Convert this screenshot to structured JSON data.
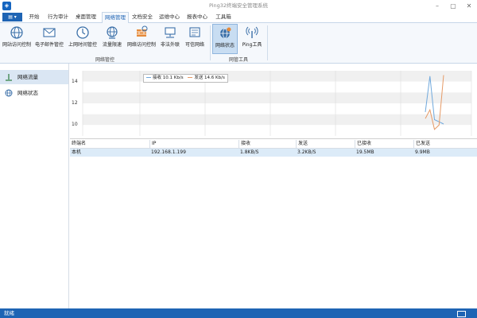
{
  "window": {
    "title": "Ping32终端安全管理系统",
    "controls": [
      "minimize-icon",
      "restore-icon",
      "close-icon"
    ]
  },
  "file_menu": {
    "label": "▤ ▾"
  },
  "tabs": [
    {
      "label": "开始"
    },
    {
      "label": "行为审计"
    },
    {
      "label": "桌面管理"
    },
    {
      "label": "网络管理",
      "active": true
    },
    {
      "label": "文档安全"
    },
    {
      "label": "运维中心"
    },
    {
      "label": "报表中心"
    },
    {
      "label": "工具箱"
    }
  ],
  "ribbon": {
    "group1": {
      "label": "网络管控",
      "buttons": [
        {
          "label": "网站访问控制",
          "icon": "globe-icon"
        },
        {
          "label": "电子邮件管控",
          "icon": "email-icon"
        },
        {
          "label": "上网时间管控",
          "icon": "clock-icon"
        },
        {
          "label": "流量限速",
          "icon": "globe-speed-icon"
        },
        {
          "label": "网络访问控制",
          "icon": "firewall-icon"
        },
        {
          "label": "非法外联",
          "icon": "monitor-network-icon"
        },
        {
          "label": "可信网络",
          "icon": "trusted-network-icon"
        }
      ]
    },
    "group2": {
      "label": "网管工具",
      "buttons": [
        {
          "label": "网络状态",
          "icon": "network-status-icon",
          "selected": true
        },
        {
          "label": "Ping工具",
          "icon": "antenna-icon"
        }
      ]
    }
  },
  "sidebar": {
    "items": [
      {
        "label": "网络流量",
        "icon": "traffic-icon",
        "active": true
      },
      {
        "label": "网络状态",
        "icon": "globe-icon"
      }
    ]
  },
  "chart_data": {
    "type": "line",
    "y_ticks": [
      "14",
      "12",
      "10"
    ],
    "ylim": [
      9,
      15
    ],
    "grid": true,
    "legend_position": "top-left",
    "x": [
      0,
      1,
      2,
      3,
      4
    ],
    "series": [
      {
        "name": "接收 10.1 Kb/s",
        "color": "#6fa8dc",
        "values": [
          11.2,
          14.5,
          10.5,
          10.3,
          10.1
        ]
      },
      {
        "name": "发送 14.6 Kb/s",
        "color": "#e69a66",
        "values": [
          10.6,
          11.4,
          9.6,
          10.0,
          14.6
        ]
      }
    ]
  },
  "table": {
    "columns": [
      "终端名",
      "IP",
      "接收",
      "发送",
      "已接收",
      "已发送"
    ],
    "rows": [
      [
        "本机",
        "192.168.1.199",
        "1.8KB/S",
        "3.2KB/S",
        "19.5MB",
        "9.9MB"
      ]
    ]
  },
  "status": {
    "text": "就绪",
    "icon": "mail-icon"
  },
  "colors": {
    "accent": "#1e64b4",
    "ribbon_bg": "#f5f8fc",
    "row_selected": "#dcebf8"
  }
}
